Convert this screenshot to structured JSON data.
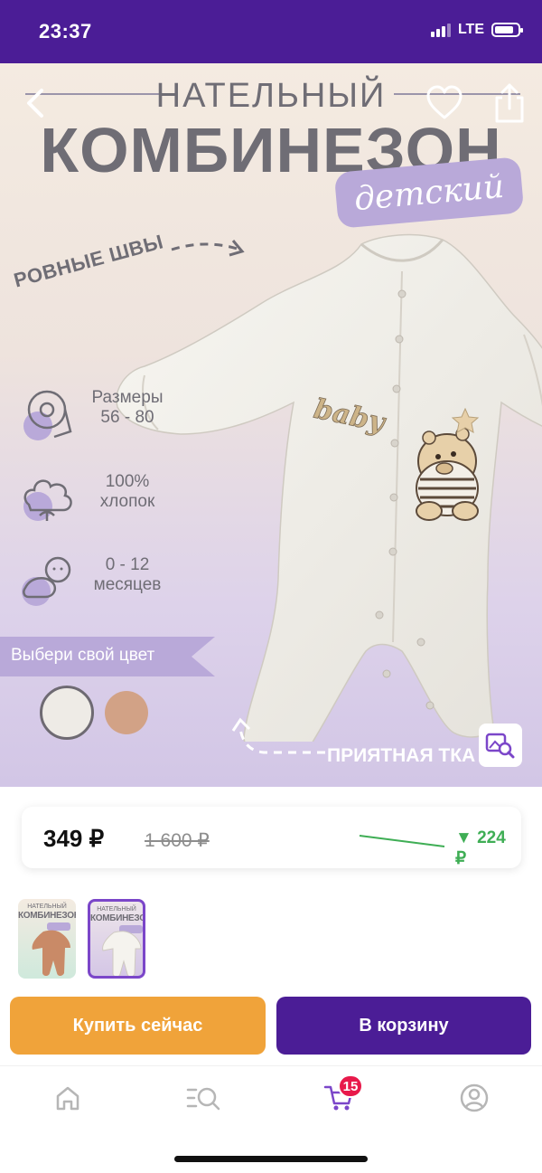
{
  "status_bar": {
    "time": "23:37",
    "network": "LTE"
  },
  "hero": {
    "title_line1": "НАТЕЛЬНЫЙ",
    "title_line2": "КОМБИНЕЗОН",
    "title_badge": "детский",
    "seams_label": "РОВНЫЕ ШВЫ",
    "features": [
      {
        "icon": "measuring-tape-icon",
        "text": "Размеры\n56 - 80"
      },
      {
        "icon": "cotton-icon",
        "text": "100%\nхлопок"
      },
      {
        "icon": "baby-icon",
        "text": "0 - 12\nмесяцев"
      }
    ],
    "color_banner": "Выбери свой цвет",
    "pleasant_label": "ПРИЯТНАЯ ТКА",
    "embroidery_text": "baby",
    "colors": {
      "swatch_white": "#eeebe6",
      "swatch_peach": "#d2a286",
      "accent": "#b9a9d9"
    }
  },
  "price": {
    "current": "349 ₽",
    "old": "1 600 ₽",
    "delta": "▼ 224 ₽",
    "delta_color": "#3fae55"
  },
  "thumbnails": [
    {
      "title1": "НАТЕЛЬНЫЙ",
      "title2": "КОМБИНЕЗОН",
      "color": "peach"
    },
    {
      "title1": "НАТЕЛЬНЫЙ",
      "title2": "КОМБИНЕЗОН",
      "color": "white",
      "selected": true
    }
  ],
  "buttons": {
    "buy_now": "Купить сейчас",
    "add_to_cart": "В корзину"
  },
  "bottom_nav": {
    "cart_badge": "15"
  },
  "theme": {
    "brand_purple": "#4b1d96",
    "buy_orange": "#f0a33a",
    "badge_red": "#e8194b"
  }
}
